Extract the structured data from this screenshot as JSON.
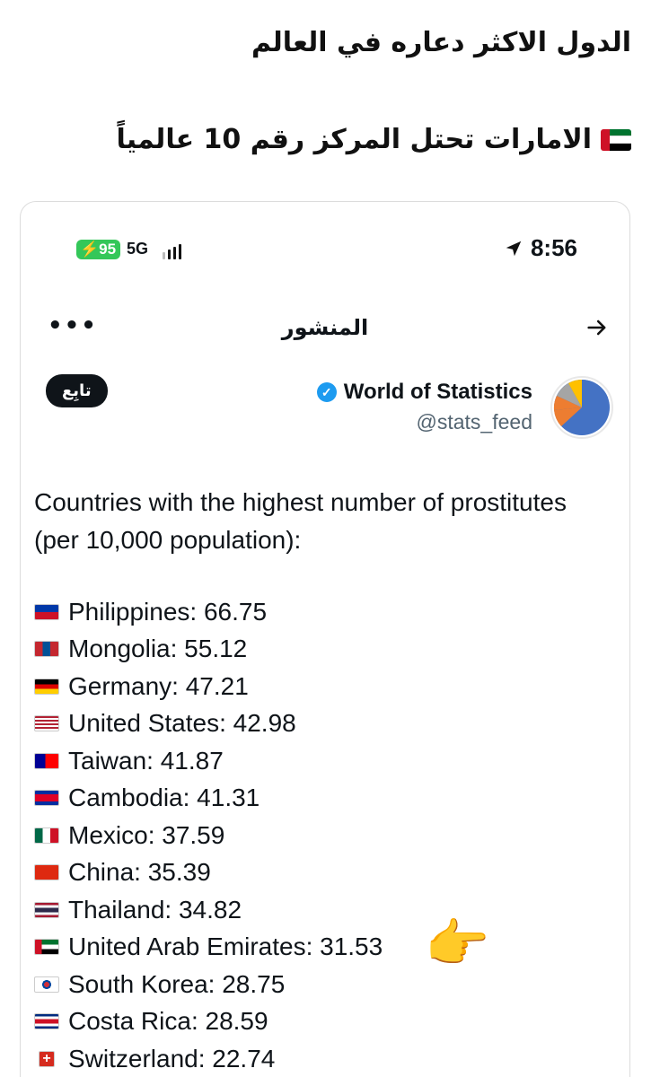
{
  "caption": {
    "line1": "الدول الاكثر دعاره في العالم",
    "line2": "الامارات تحتل المركز رقم 10 عالمياً"
  },
  "status_bar": {
    "battery": "95",
    "network": "5G",
    "time": "8:56"
  },
  "header": {
    "title": "المنشور",
    "more_icon": "more-horizontal-icon",
    "back_icon": "arrow-right-icon"
  },
  "author": {
    "name": "World of Statistics",
    "handle": "@stats_feed",
    "follow_label": "تابِع",
    "verified_color": "#1d9bf0"
  },
  "post": {
    "text": "Countries with the highest number of prostitutes (per 10,000 population):",
    "items": [
      {
        "label": "Philippines: 66.75",
        "flag": "philippines"
      },
      {
        "label": "Mongolia: 55.12",
        "flag": "mongolia"
      },
      {
        "label": "Germany: 47.21",
        "flag": "germany"
      },
      {
        "label": "United States: 42.98",
        "flag": "united-states"
      },
      {
        "label": "Taiwan: 41.87",
        "flag": "taiwan"
      },
      {
        "label": "Cambodia: 41.31",
        "flag": "cambodia"
      },
      {
        "label": "Mexico: 37.59",
        "flag": "mexico"
      },
      {
        "label": "China: 35.39",
        "flag": "china"
      },
      {
        "label": "Thailand: 34.82",
        "flag": "thailand"
      },
      {
        "label": "United Arab Emirates: 31.53",
        "flag": "uae"
      },
      {
        "label": "South Korea: 28.75",
        "flag": "south-korea"
      },
      {
        "label": "Costa Rica: 28.59",
        "flag": "costa-rica"
      },
      {
        "label": "Switzerland: 22.74",
        "flag": "switzerland"
      }
    ]
  }
}
